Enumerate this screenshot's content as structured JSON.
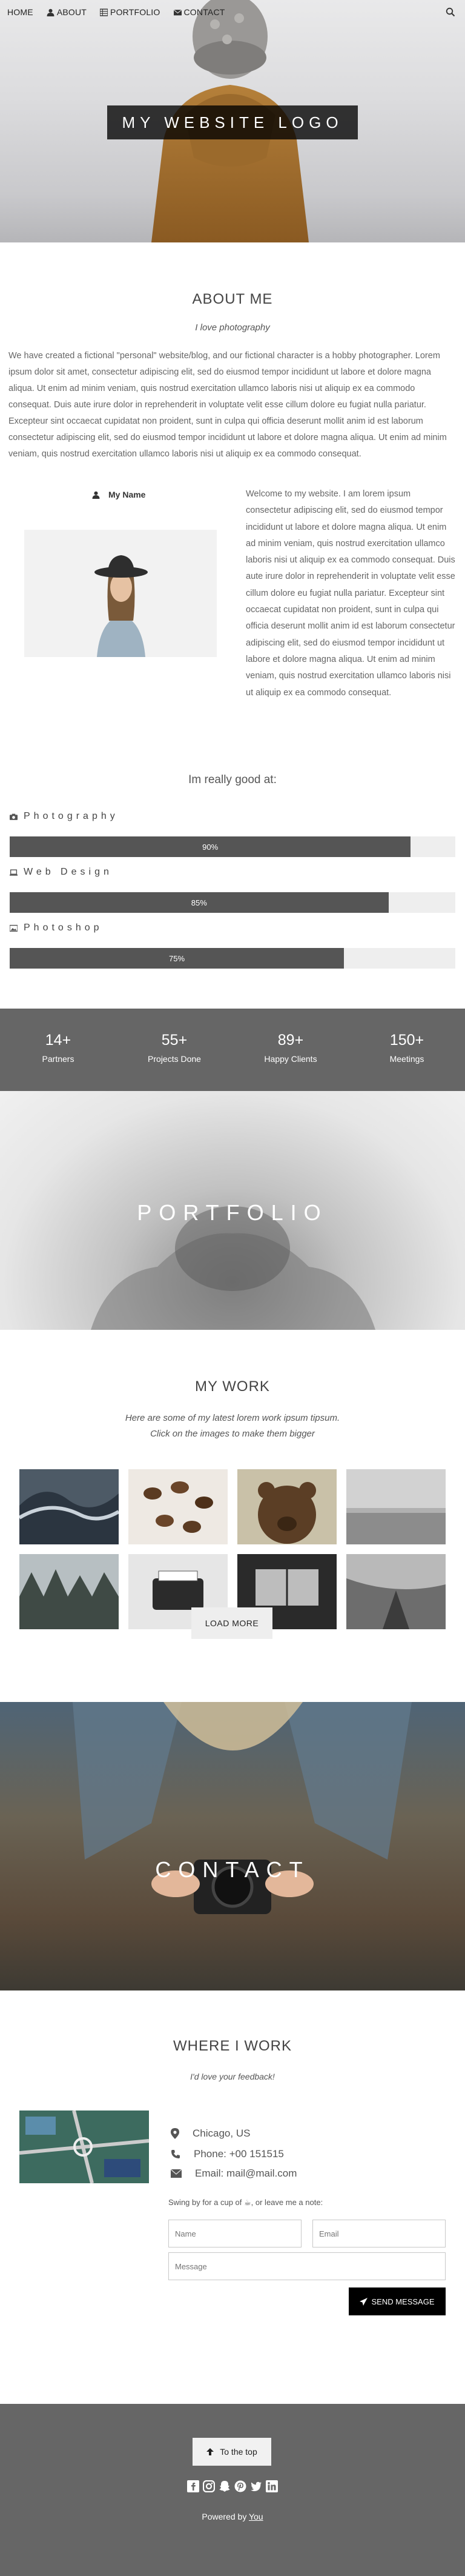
{
  "nav": {
    "items": [
      {
        "label": "HOME",
        "icon": ""
      },
      {
        "label": "ABOUT",
        "icon": "user-icon"
      },
      {
        "label": "PORTFOLIO",
        "icon": "th-icon"
      },
      {
        "label": "CONTACT",
        "icon": "envelope-icon"
      }
    ],
    "search_icon": "search-icon"
  },
  "hero": {
    "logo_text": "MY WEBSITE LOGO"
  },
  "about": {
    "title": "ABOUT ME",
    "subtitle": "I love photography",
    "paragraph": "We have created a fictional \"personal\" website/blog, and our fictional character is a hobby photographer. Lorem ipsum dolor sit amet, consectetur adipiscing elit, sed do eiusmod tempor incididunt ut labore et dolore magna aliqua. Ut enim ad minim veniam, quis nostrud exercitation ullamco laboris nisi ut aliquip ex ea commodo consequat. Duis aute irure dolor in reprehenderit in voluptate velit esse cillum dolore eu fugiat nulla pariatur. Excepteur sint occaecat cupidatat non proident, sunt in culpa qui officia deserunt mollit anim id est laborum consectetur adipiscing elit, sed do eiusmod tempor incididunt ut labore et dolore magna aliqua. Ut enim ad minim veniam, quis nostrud exercitation ullamco laboris nisi ut aliquip ex ea commodo consequat.",
    "name": "My Name",
    "bio": "Welcome to my website. I am lorem ipsum consectetur adipiscing elit, sed do eiusmod tempor incididunt ut labore et dolore magna aliqua. Ut enim ad minim veniam, quis nostrud exercitation ullamco laboris nisi ut aliquip ex ea commodo consequat. Duis aute irure dolor in reprehenderit in voluptate velit esse cillum dolore eu fugiat nulla pariatur. Excepteur sint occaecat cupidatat non proident, sunt in culpa qui officia deserunt mollit anim id est laborum consectetur adipiscing elit, sed do eiusmod tempor incididunt ut labore et dolore magna aliqua. Ut enim ad minim veniam, quis nostrud exercitation ullamco laboris nisi ut aliquip ex ea commodo consequat."
  },
  "skills": {
    "title": "Im really good at:",
    "items": [
      {
        "label": "Photography",
        "percent": 90,
        "percent_label": "90%",
        "icon": "camera-icon"
      },
      {
        "label": "Web Design",
        "percent": 85,
        "percent_label": "85%",
        "icon": "laptop-icon"
      },
      {
        "label": "Photoshop",
        "percent": 75,
        "percent_label": "75%",
        "icon": "image-icon"
      }
    ]
  },
  "stats": [
    {
      "value": "14+",
      "label": "Partners"
    },
    {
      "value": "55+",
      "label": "Projects Done"
    },
    {
      "value": "89+",
      "label": "Happy Clients"
    },
    {
      "value": "150+",
      "label": "Meetings"
    }
  ],
  "portfolio": {
    "banner": "PORTFOLIO"
  },
  "work": {
    "title": "MY WORK",
    "subtitle_line1": "Here are some of my latest lorem work ipsum tipsum.",
    "subtitle_line2": "Click on the images to make them bigger",
    "load_more": "LOAD MORE"
  },
  "contact": {
    "banner": "CONTACT"
  },
  "where": {
    "title": "WHERE I WORK",
    "subtitle": "I'd love your feedback!",
    "location": "Chicago, US",
    "phone": "Phone: +00 151515",
    "email": "Email: mail@mail.com",
    "note": "Swing by for a cup of ☕, or leave me a note:",
    "name_placeholder": "Name",
    "email_placeholder": "Email",
    "message_placeholder": "Message",
    "send_label": "SEND MESSAGE"
  },
  "footer": {
    "top_label": "To the top",
    "powered_prefix": "Powered by ",
    "powered_link": "You",
    "social_icons": [
      "facebook-icon",
      "instagram-icon",
      "snapchat-icon",
      "pinterest-icon",
      "twitter-icon",
      "linkedin-icon"
    ]
  },
  "colors": {
    "dark": "#555555",
    "footer_bg": "#666666",
    "bar_bg": "#eeeeee",
    "button_black": "#000000"
  }
}
